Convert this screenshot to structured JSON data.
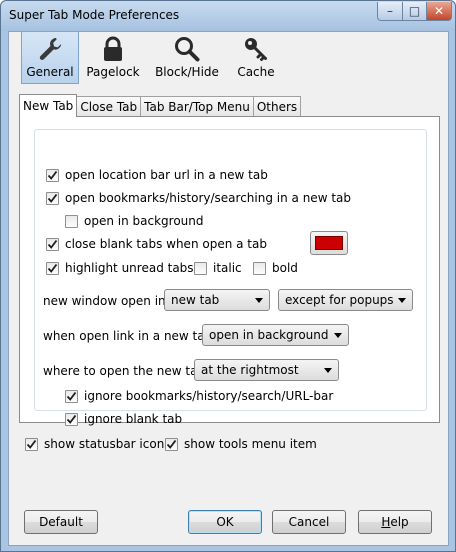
{
  "window": {
    "title": "Super Tab Mode Preferences",
    "controls": {
      "minimize": "–",
      "maximize": "□",
      "close": "✕"
    }
  },
  "panes": [
    {
      "label": "General",
      "icon": "wrench-icon",
      "selected": true
    },
    {
      "label": "Pagelock",
      "icon": "padlock-icon",
      "selected": false
    },
    {
      "label": "Block/Hide",
      "icon": "magnifier-icon",
      "selected": false
    },
    {
      "label": "Cache",
      "icon": "key-icon",
      "selected": false
    }
  ],
  "tabs": [
    {
      "label": "New Tab",
      "selected": true
    },
    {
      "label": "Close Tab",
      "selected": false
    },
    {
      "label": "Tab Bar/Top Menu",
      "selected": false
    },
    {
      "label": "Others",
      "selected": false
    }
  ],
  "options": {
    "open_location": {
      "label": "open location bar url in a new tab",
      "checked": true
    },
    "open_bookmarks": {
      "label": "open bookmarks/history/searching in a new tab",
      "checked": true
    },
    "open_background": {
      "label": "open in background",
      "checked": false
    },
    "close_blank": {
      "label": "close blank tabs when open a tab",
      "checked": true
    },
    "highlight_unread": {
      "label": "highlight unread tabs",
      "checked": true
    },
    "italic": {
      "label": "italic",
      "checked": false
    },
    "bold": {
      "label": "bold",
      "checked": false
    },
    "highlight_color": "#cc0000",
    "new_window_label": "new window open in",
    "new_window_value": "new tab",
    "new_window_except_value": "except for popups",
    "open_link_label": "when open link in a new tab",
    "open_link_value": "open in background",
    "where_label": "where to open the new tab",
    "where_value": "at the rightmost",
    "ignore_bookmarks": {
      "label": "ignore bookmarks/history/search/URL-bar",
      "checked": true
    },
    "ignore_blank": {
      "label": "ignore blank tab",
      "checked": true
    }
  },
  "bottom": {
    "statusbar_icon": {
      "label": "show statusbar icon",
      "checked": true
    },
    "tools_menu": {
      "label": "show tools menu item",
      "checked": true
    }
  },
  "buttons": {
    "default": "Default",
    "ok": "OK",
    "cancel": "Cancel",
    "help_prefix": "H",
    "help_rest": "elp"
  }
}
